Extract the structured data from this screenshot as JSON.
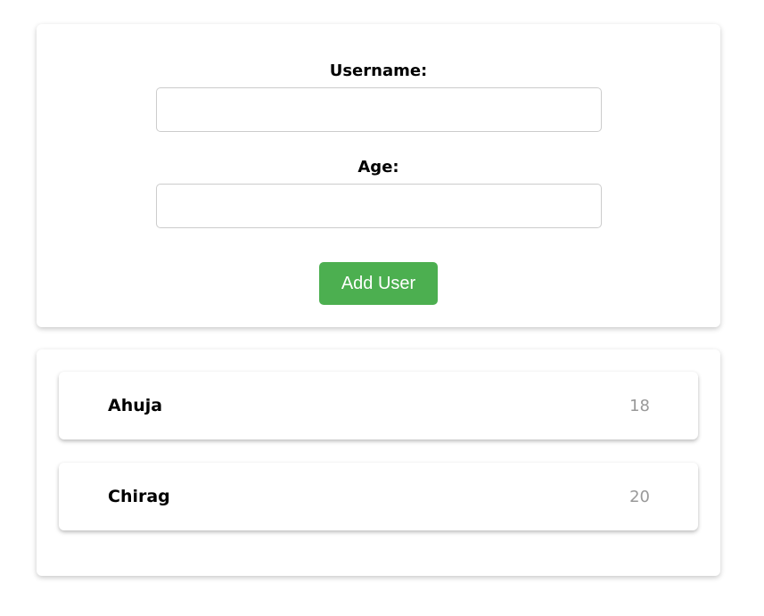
{
  "form": {
    "username_label": "Username:",
    "username_value": "",
    "age_label": "Age:",
    "age_value": "",
    "submit_label": "Add User"
  },
  "users": [
    {
      "name": "Ahuja",
      "age": "18"
    },
    {
      "name": "Chirag",
      "age": "20"
    }
  ],
  "colors": {
    "button": "#4caf50",
    "button_text": "#ffffff",
    "age_text": "#999999",
    "input_border": "#cccccc"
  }
}
